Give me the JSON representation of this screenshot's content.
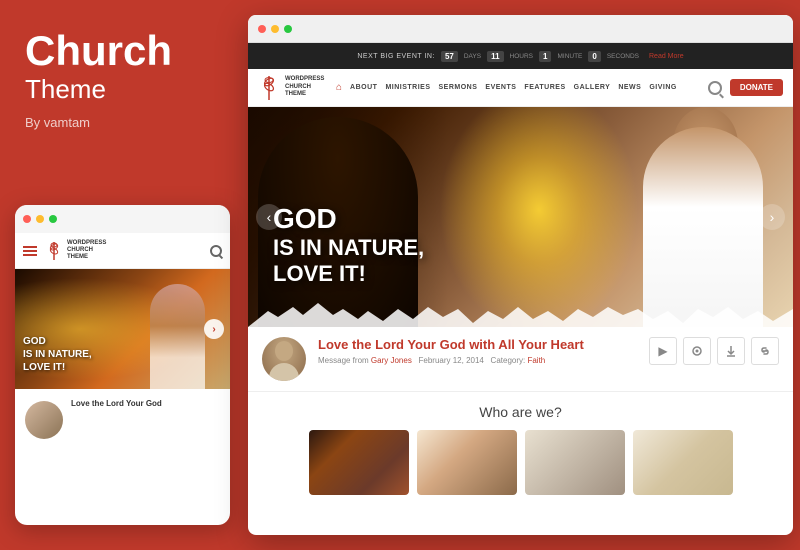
{
  "left": {
    "title": "Church",
    "subtitle": "Theme",
    "author": "By vamtam"
  },
  "browser": {
    "window_dots": [
      "red",
      "yellow",
      "green"
    ]
  },
  "event_bar": {
    "prefix": "NEXT BIG EVENT IN:",
    "days_count": "57",
    "days_label": "DAYS",
    "hours_count": "11",
    "hours_label": "HOURS",
    "minutes_count": "1",
    "minutes_label": "MINUTE",
    "seconds_count": "0",
    "seconds_label": "SECONDS",
    "read_more": "Read More"
  },
  "navbar": {
    "logo_lines": [
      "WORDPRESS",
      "CHURCH",
      "THEME"
    ],
    "home_icon": "⌂",
    "items": [
      "ABOUT",
      "MINISTRIES",
      "SERMONS",
      "EVENTS",
      "FEATURES",
      "GALLERY",
      "NEWS",
      "GIVING"
    ],
    "donate_label": "Donate"
  },
  "hero": {
    "line1": "GOD",
    "line2": "IS IN NATURE,",
    "line3": "LOVE IT!",
    "arrow_left": "‹",
    "arrow_right": "›"
  },
  "message": {
    "title": "Love the Lord Your God with All Your Heart",
    "meta_prefix": "Message from",
    "author": "Gary Jones",
    "date": "February 12, 2014",
    "category_prefix": "Category:",
    "category": "Faith",
    "icon_video": "▶",
    "icon_headphone": "♪",
    "icon_download": "⬇",
    "icon_link": "🔗"
  },
  "who_section": {
    "title": "Who are we?"
  },
  "mobile": {
    "logo_text": [
      "WORDPRESS",
      "CHURCH",
      "THEME"
    ],
    "hero_text_line1": "GOD",
    "hero_text_line2": "IS IN NATURE,",
    "hero_text_line3": "LOVE IT!",
    "card_title": "Love the Lord Your God"
  }
}
